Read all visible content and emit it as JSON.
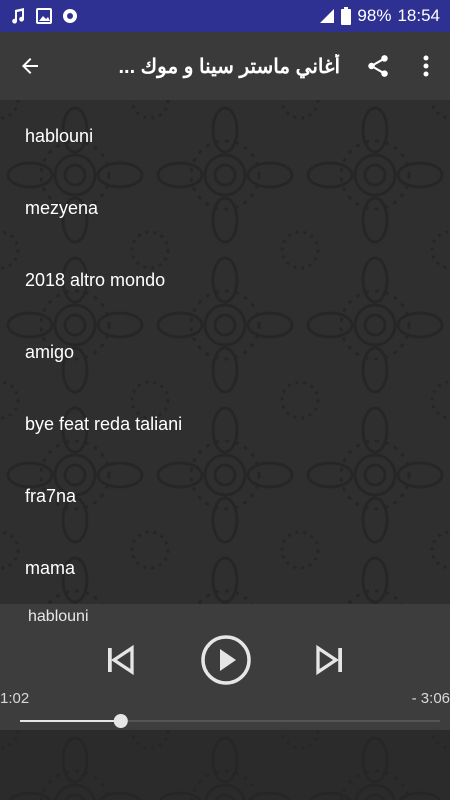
{
  "status": {
    "battery": "98%",
    "time": "18:54"
  },
  "toolbar": {
    "title": "أغاني ماستر سينا و موك ..."
  },
  "songs": [
    "hablouni",
    "mezyena",
    "2018  altro mondo",
    "amigo",
    "bye feat reda taliani",
    "fra7na",
    "mama"
  ],
  "player": {
    "now_playing": "hablouni",
    "elapsed": "1:02",
    "remaining": "- 3:06",
    "progress": 0.24
  },
  "colors": {
    "status_bar": "#2e3192",
    "toolbar": "#3a3a3a",
    "player": "#3d3d3d"
  },
  "icons": [
    "music-note-icon",
    "image-icon",
    "settings-icon",
    "signal-icon",
    "battery-icon",
    "back-arrow-icon",
    "share-icon",
    "more-vert-icon",
    "skip-previous-icon",
    "play-circle-icon",
    "skip-next-icon"
  ]
}
